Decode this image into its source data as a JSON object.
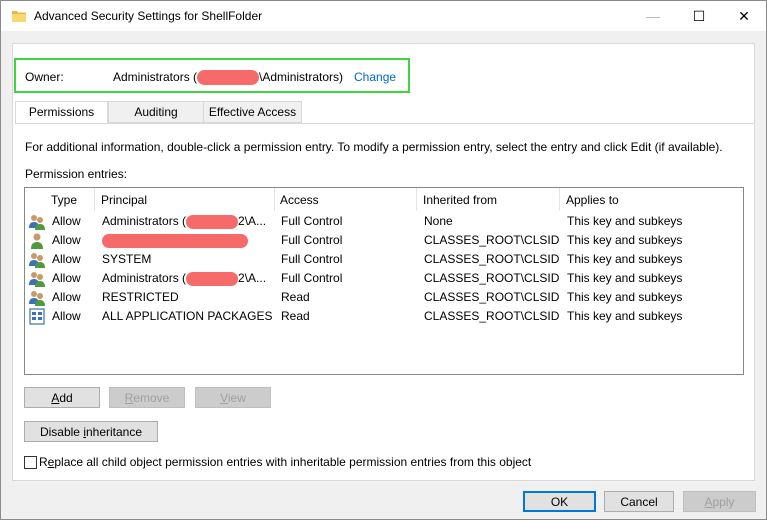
{
  "window": {
    "title": "Advanced Security Settings for ShellFolder",
    "minimize_glyph": "—",
    "maximize_glyph": "☐",
    "close_glyph": "✕"
  },
  "owner": {
    "label": "Owner:",
    "value_prefix": "Administrators (",
    "value_suffix": "\\Administrators)",
    "change_link": "Change"
  },
  "tabs": [
    {
      "label": "Permissions",
      "active": true
    },
    {
      "label": "Auditing",
      "active": false
    },
    {
      "label": "Effective Access",
      "active": false
    }
  ],
  "permissions": {
    "info_text": "For additional information, double-click a permission entry. To modify a permission entry, select the entry and click Edit (if available).",
    "entries_label": "Permission entries:",
    "columns": [
      "Type",
      "Principal",
      "Access",
      "Inherited from",
      "Applies to"
    ],
    "rows": [
      {
        "icon": "group-icon",
        "type": "Allow",
        "principal_prefix": "Administrators (",
        "principal_suffix": "2\\A...",
        "access": "Full Control",
        "inherited": "None",
        "applies": "This key and subkeys"
      },
      {
        "icon": "user-icon",
        "type": "Allow",
        "principal_prefix": "",
        "principal_suffix": "",
        "access": "Full Control",
        "inherited": "CLASSES_ROOT\\CLSID",
        "applies": "This key and subkeys"
      },
      {
        "icon": "group-icon",
        "type": "Allow",
        "principal_prefix": "SYSTEM",
        "principal_suffix": "",
        "access": "Full Control",
        "inherited": "CLASSES_ROOT\\CLSID",
        "applies": "This key and subkeys"
      },
      {
        "icon": "group-icon",
        "type": "Allow",
        "principal_prefix": "Administrators (",
        "principal_suffix": "2\\A...",
        "access": "Full Control",
        "inherited": "CLASSES_ROOT\\CLSID",
        "applies": "This key and subkeys"
      },
      {
        "icon": "group-icon",
        "type": "Allow",
        "principal_prefix": "RESTRICTED",
        "principal_suffix": "",
        "access": "Read",
        "inherited": "CLASSES_ROOT\\CLSID",
        "applies": "This key and subkeys"
      },
      {
        "icon": "app-packages-icon",
        "type": "Allow",
        "principal_prefix": "ALL APPLICATION PACKAGES",
        "principal_suffix": "",
        "access": "Read",
        "inherited": "CLASSES_ROOT\\CLSID",
        "applies": "This key and subkeys"
      }
    ],
    "buttons": {
      "add_u": "A",
      "add_rest": "dd",
      "remove_u": "R",
      "remove_rest": "emove",
      "view_u": "V",
      "view_rest": "iew",
      "disable_pre": "Disable ",
      "disable_u": "i",
      "disable_rest": "nheritance"
    },
    "replace_checkbox_pre": "R",
    "replace_checkbox_u": "e",
    "replace_checkbox_rest": "place all child object permission entries with inheritable permission entries from this object",
    "replace_checked": false
  },
  "footer": {
    "ok": "OK",
    "cancel": "Cancel",
    "apply_u": "A",
    "apply_rest": "pply"
  },
  "colors": {
    "owner_highlight": "#3ed63e",
    "link": "#0066cc",
    "redaction": "#f76a6a",
    "default_button_border": "#0078d7"
  }
}
